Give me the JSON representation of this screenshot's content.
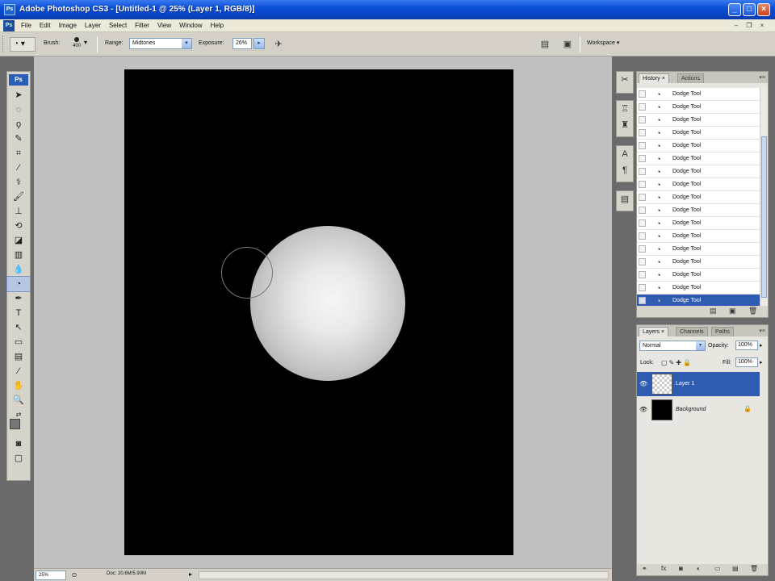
{
  "window": {
    "title": "Adobe Photoshop CS3 - [Untitled-1 @ 25% (Layer 1, RGB/8)]",
    "app_icon": "Ps",
    "minimize_label": "_",
    "maximize_label": "□",
    "close_label": "×"
  },
  "menubar": {
    "items": [
      "File",
      "Edit",
      "Image",
      "Layer",
      "Select",
      "Filter",
      "View",
      "Window",
      "Help"
    ]
  },
  "options": {
    "brush_label": "Brush:",
    "brush_size": "400",
    "range_label": "Range:",
    "range_value": "Midtones",
    "exposure_label": "Exposure:",
    "exposure_value": "26%",
    "workspace_label": "Workspace ▾"
  },
  "toolbox": {
    "logo": "Ps",
    "tools": [
      {
        "name": "move-tool-icon",
        "glyph": "➤"
      },
      {
        "name": "marquee-tool-icon",
        "glyph": "◌"
      },
      {
        "name": "lasso-tool-icon",
        "glyph": "ϙ"
      },
      {
        "name": "quick-selection-tool-icon",
        "glyph": "✎"
      },
      {
        "name": "crop-tool-icon",
        "glyph": "⌗"
      },
      {
        "name": "slice-tool-icon",
        "glyph": "⁄"
      },
      {
        "name": "healing-brush-icon",
        "glyph": "⚕"
      },
      {
        "name": "brush-tool-icon",
        "glyph": "🖌"
      },
      {
        "name": "clone-stamp-icon",
        "glyph": "⊥"
      },
      {
        "name": "history-brush-icon",
        "glyph": "⟲"
      },
      {
        "name": "eraser-tool-icon",
        "glyph": "◪"
      },
      {
        "name": "gradient-tool-icon",
        "glyph": "▥"
      },
      {
        "name": "blur-tool-icon",
        "glyph": "💧"
      },
      {
        "name": "dodge-tool-icon",
        "glyph": "◔"
      },
      {
        "name": "pen-tool-icon",
        "glyph": "✒"
      },
      {
        "name": "type-tool-icon",
        "glyph": "T"
      },
      {
        "name": "path-selection-icon",
        "glyph": "↖"
      },
      {
        "name": "shape-tool-icon",
        "glyph": "▭"
      },
      {
        "name": "notes-tool-icon",
        "glyph": "▤"
      },
      {
        "name": "eyedropper-tool-icon",
        "glyph": "⁄"
      },
      {
        "name": "hand-tool-icon",
        "glyph": "✋"
      },
      {
        "name": "zoom-tool-icon",
        "glyph": "🔍"
      }
    ],
    "active_tool": "dodge-tool-icon",
    "foreground_color": "#777777",
    "background_color": "#ffffff"
  },
  "status": {
    "zoom": "25%",
    "doc": "Doc: 20.6M/5.90M",
    "arrow": "▸"
  },
  "history_panel": {
    "tabs": [
      "History ×",
      "Actions"
    ],
    "items": [
      "Dodge Tool",
      "Dodge Tool",
      "Dodge Tool",
      "Dodge Tool",
      "Dodge Tool",
      "Dodge Tool",
      "Dodge Tool",
      "Dodge Tool",
      "Dodge Tool",
      "Dodge Tool",
      "Dodge Tool",
      "Dodge Tool",
      "Dodge Tool",
      "Dodge Tool",
      "Dodge Tool",
      "Dodge Tool",
      "Dodge Tool"
    ],
    "selected_index": 16
  },
  "layers_panel": {
    "tabs": [
      "Layers ×",
      "Channels",
      "Paths"
    ],
    "blend_mode": "Normal",
    "opacity_label": "Opacity:",
    "opacity_value": "100%",
    "lock_label": "Lock:",
    "fill_label": "Fill:",
    "fill_value": "100%",
    "layers": [
      {
        "name": "Layer 1",
        "selected": true,
        "thumb": "transparent"
      },
      {
        "name": "Background",
        "selected": false,
        "thumb": "black",
        "locked": true
      }
    ]
  },
  "colors": {
    "titlebar": "#0a4fd6",
    "selection": "#2f5bb0",
    "canvas_bg": "#c0c0c0",
    "document": "#000000"
  }
}
